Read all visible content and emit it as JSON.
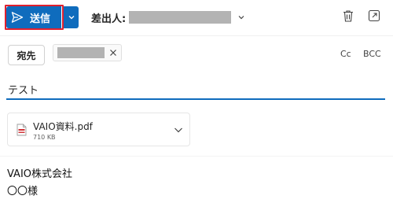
{
  "toolbar": {
    "send_label": "送信",
    "send_icon": "paper-plane-icon",
    "send_dropdown_icon": "chevron-down-icon",
    "from_label": "差出人:",
    "from_dropdown_icon": "chevron-down-icon",
    "discard_icon": "trash-icon",
    "popout_icon": "pop-out-icon"
  },
  "recipients": {
    "to_label": "宛先",
    "remove_icon": "close-icon",
    "cc_label": "Cc",
    "bcc_label": "BCC"
  },
  "subject": {
    "value": "テスト"
  },
  "attachment": {
    "name": "VAIO資料.pdf",
    "size": "710 KB",
    "icon": "pdf-file-icon",
    "menu_icon": "chevron-down-icon"
  },
  "body": {
    "lines": [
      "VAIO株式会社",
      "〇〇様"
    ]
  },
  "colors": {
    "accent": "#0f6cbd",
    "highlight": "#e0202e",
    "redacted": "#b3b3b3"
  }
}
